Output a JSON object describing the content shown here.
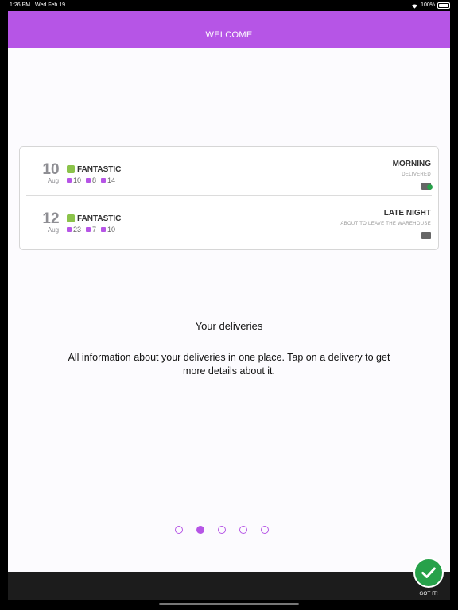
{
  "status_bar": {
    "time": "1:26 PM",
    "date": "Wed Feb 19",
    "battery": "100%"
  },
  "nav": {
    "title": "WELCOME"
  },
  "deliveries": [
    {
      "day": "10",
      "month": "Aug",
      "rating": "FANTASTIC",
      "counts": [
        "10",
        "8",
        "14"
      ],
      "slot": "MORNING",
      "status": "DELIVERED"
    },
    {
      "day": "12",
      "month": "Aug",
      "rating": "FANTASTIC",
      "counts": [
        "23",
        "7",
        "10"
      ],
      "slot": "LATE NIGHT",
      "status": "ABOUT TO LEAVE THE WAREHOUSE"
    }
  ],
  "onboarding": {
    "title": "Your deliveries",
    "description": "All information about your deliveries in one place. Tap on a delivery to get more details about it.",
    "page_count": 5,
    "current_page": 2
  },
  "got_it": {
    "label": "GOT IT!"
  },
  "colors": {
    "accent": "#b655e6",
    "rating_green": "#8bc34a",
    "confirm_green": "#27a14a"
  }
}
